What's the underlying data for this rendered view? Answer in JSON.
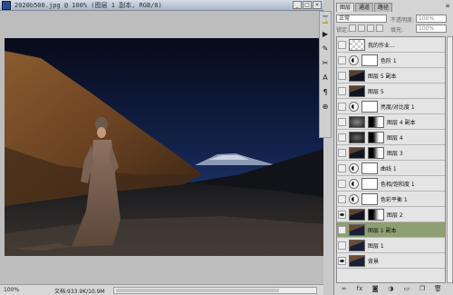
{
  "document": {
    "title": "2020b500.jpg @ 100% (图层 1 副本, RGB/8)",
    "zoom": "100%",
    "doc_size": "文档:933.9K/10.9M"
  },
  "layers_panel": {
    "tabs": [
      "图层",
      "通道",
      "路径"
    ],
    "blend_mode": "正常",
    "opacity_label": "不透明度:",
    "opacity_value": "100%",
    "lock_label": "锁定:",
    "fill_label": "填充:",
    "fill_value": "100%",
    "layers": [
      {
        "name": "我的作业...",
        "kind": "text",
        "visible": false,
        "fx": ""
      },
      {
        "name": "色阶 1",
        "kind": "adjustment",
        "visible": false,
        "fx": ""
      },
      {
        "name": "图层 5 副本",
        "kind": "pixel",
        "visible": false,
        "fx": ""
      },
      {
        "name": "图层 5",
        "kind": "pixel",
        "visible": false,
        "fx": ""
      },
      {
        "name": "亮度/对比度 1",
        "kind": "adjustment",
        "visible": false,
        "fx": ""
      },
      {
        "name": "图层 4 副本",
        "kind": "masked",
        "visible": false,
        "fx": ""
      },
      {
        "name": "图层 4",
        "kind": "masked",
        "visible": false,
        "fx": ""
      },
      {
        "name": "图层 3",
        "kind": "masked",
        "visible": false,
        "fx": ""
      },
      {
        "name": "曲线 1",
        "kind": "adjustment",
        "visible": false,
        "fx": ""
      },
      {
        "name": "色相/饱和度 1",
        "kind": "adjustment",
        "visible": false,
        "fx": ""
      },
      {
        "name": "色彩平衡 1",
        "kind": "adjustment",
        "visible": false,
        "fx": ""
      },
      {
        "name": "图层 2",
        "kind": "masked",
        "visible": true,
        "fx": ""
      },
      {
        "name": "图层 1 副本",
        "kind": "pixel",
        "visible": false,
        "fx": "",
        "selected": true
      },
      {
        "name": "图层 1",
        "kind": "pixel",
        "visible": false,
        "fx": ""
      },
      {
        "name": "背景",
        "kind": "pixel",
        "visible": true,
        "fx": ""
      }
    ],
    "footer_icons": [
      "link-icon",
      "fx-icon",
      "mask-icon",
      "adjustment-icon",
      "folder-icon",
      "new-layer-icon",
      "trash-icon"
    ]
  },
  "tool_dock": {
    "icons": [
      "history-icon",
      "actions-icon",
      "brush-icon",
      "tool-presets-icon",
      "character-icon",
      "paragraph-icon",
      "clone-source-icon"
    ]
  }
}
